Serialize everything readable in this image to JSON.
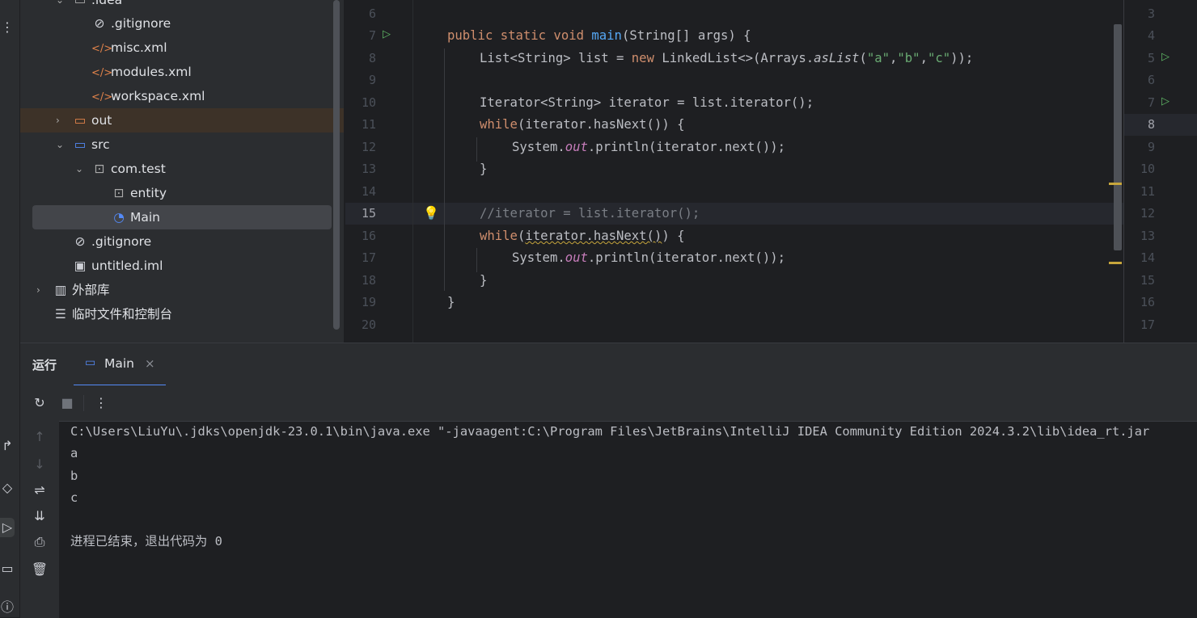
{
  "project": {
    "items": [
      {
        "label": ".idea",
        "icon": "folder-icon"
      },
      {
        "label": ".gitignore",
        "icon": "ignore-file-icon"
      },
      {
        "label": "misc.xml",
        "icon": "xml-file-icon"
      },
      {
        "label": "modules.xml",
        "icon": "xml-file-icon"
      },
      {
        "label": "workspace.xml",
        "icon": "xml-file-icon"
      },
      {
        "label": "out",
        "icon": "folder-icon"
      },
      {
        "label": "src",
        "icon": "source-folder-icon"
      },
      {
        "label": "com.test",
        "icon": "package-icon"
      },
      {
        "label": "entity",
        "icon": "package-icon"
      },
      {
        "label": "Main",
        "icon": "java-class-icon"
      },
      {
        "label": ".gitignore",
        "icon": "ignore-file-icon"
      },
      {
        "label": "untitled.iml",
        "icon": "module-file-icon"
      },
      {
        "label": "外部库",
        "icon": "library-icon"
      },
      {
        "label": "临时文件和控制台",
        "icon": "scratches-icon"
      }
    ]
  },
  "editor": {
    "line_numbers": [
      "6",
      "7",
      "8",
      "9",
      "10",
      "11",
      "12",
      "13",
      "14",
      "15",
      "16",
      "17",
      "18",
      "19",
      "20"
    ],
    "current_line": "15",
    "lines": {
      "l7": {
        "a": "public static void ",
        "b": "main",
        "c": "(String[] args) {"
      },
      "l8": {
        "a": "List<String> list = ",
        "b": "new ",
        "c": "LinkedList<>(Arrays.",
        "d": "asList",
        "e": "(",
        "f": "\"a\"",
        "g": ",",
        "h": "\"b\"",
        "i": ",",
        "j": "\"c\"",
        "k": "));"
      },
      "l10": "Iterator<String> iterator = list.iterator();",
      "l11": {
        "a": "while",
        "b": "(iterator.hasNext()) {"
      },
      "l12": {
        "a": "System.",
        "b": "out",
        "c": ".println(iterator.next());"
      },
      "l13": "}",
      "l15": "//iterator = list.iterator();",
      "l16": {
        "a": "while",
        "b": "(",
        "c": "iterator.hasNext()",
        "d": ") {"
      },
      "l17": {
        "a": "System.",
        "b": "out",
        "c": ".println(iterator.next());"
      },
      "l18": "}",
      "l19": "}"
    }
  },
  "right_split": {
    "line_numbers": [
      "3",
      "4",
      "5",
      "6",
      "7",
      "8",
      "9",
      "10",
      "11",
      "12",
      "13",
      "14",
      "15",
      "16",
      "17"
    ],
    "current_line": "8"
  },
  "run_panel": {
    "title": "运行",
    "tab_label": "Main",
    "console_lines": [
      "C:\\Users\\LiuYu\\.jdks\\openjdk-23.0.1\\bin\\java.exe \"-javaagent:C:\\Program Files\\JetBrains\\IntelliJ IDEA Community Edition 2024.3.2\\lib\\idea_rt.jar",
      "a",
      "b",
      "c",
      "",
      "进程已结束，退出代码为 0"
    ]
  },
  "colors": {
    "accent": "#548af7",
    "keyword": "#cf8e6d",
    "method": "#56a8f5",
    "string": "#6aab73",
    "static_field": "#c77dbb",
    "run_gutter": "#5fb865"
  }
}
